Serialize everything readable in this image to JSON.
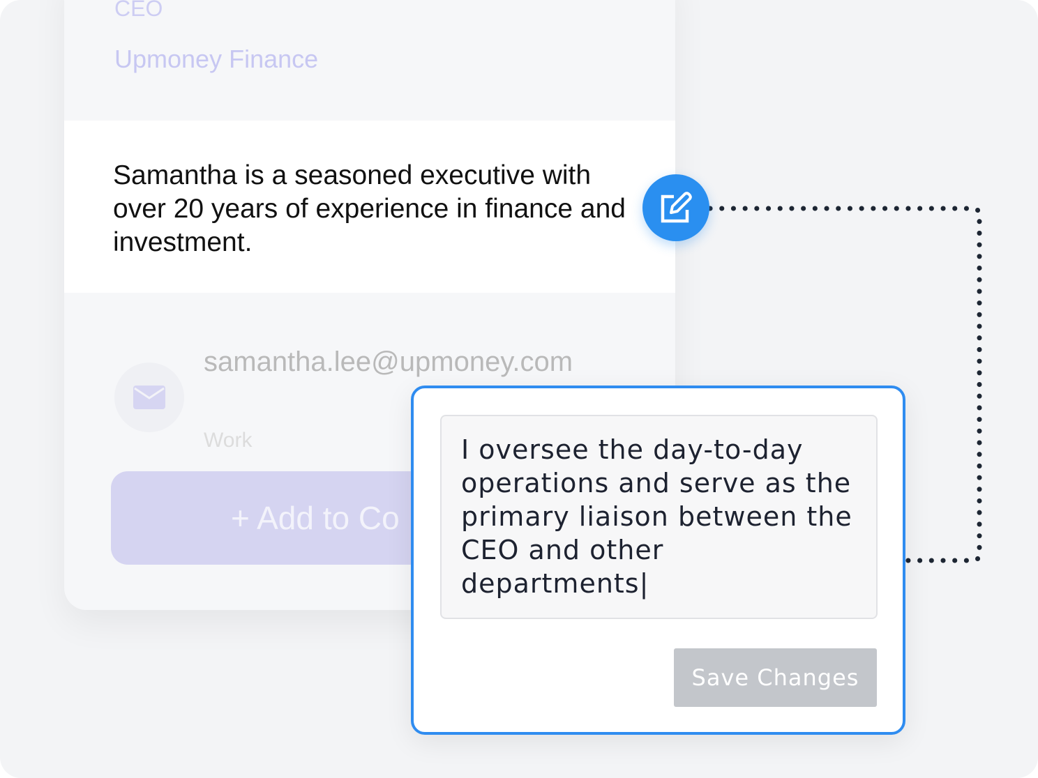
{
  "profile": {
    "role": "CEO",
    "company": "Upmoney Finance",
    "bio": "Samantha is a seasoned executive with over 20 years of experience in finance and investment.",
    "email": "samantha.lee@upmoney.com",
    "email_type": "Work",
    "add_button": "+ Add to Co"
  },
  "editor": {
    "text": "I oversee the day-to-day operations and serve as the primary liaison between the CEO and other departments|",
    "save_label": "Save Changes"
  },
  "colors": {
    "accent": "#2a8ff0",
    "save_disabled": "#c3c6cb",
    "lavender": "#d5d4f1"
  },
  "icons": {
    "edit": "edit-icon",
    "mail": "mail-icon"
  }
}
